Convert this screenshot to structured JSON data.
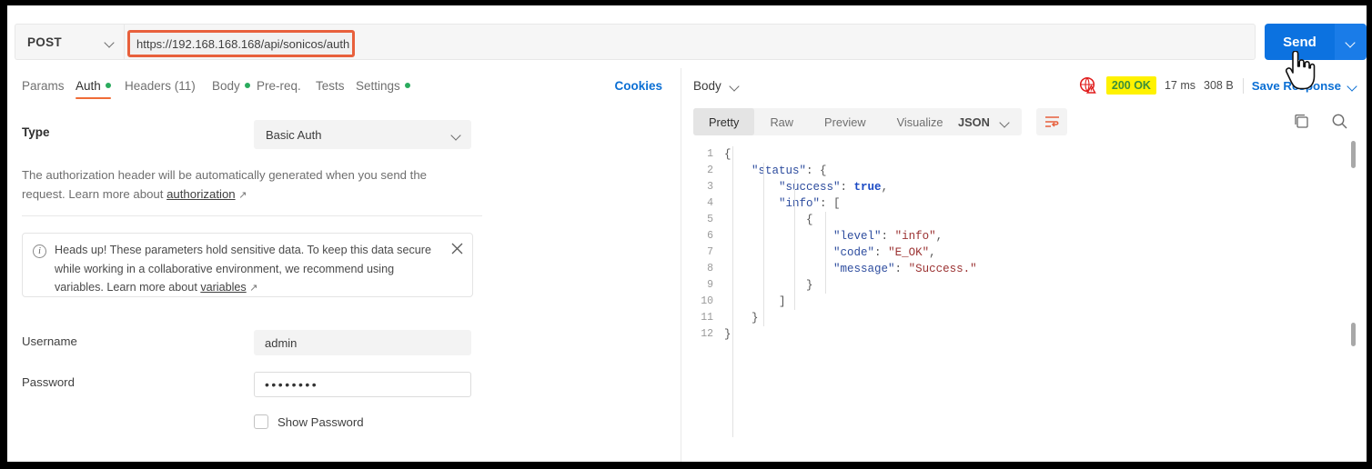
{
  "request": {
    "method": "POST",
    "url": "https://192.168.168.168/api/sonicos/auth",
    "send_label": "Send",
    "tabs": [
      {
        "label": "Params",
        "active": false,
        "dot": false
      },
      {
        "label": "Auth",
        "active": true,
        "dot": true
      },
      {
        "label": "Headers (11)",
        "active": false,
        "dot": false
      },
      {
        "label": "Body",
        "active": false,
        "dot": true
      },
      {
        "label": "Pre-req.",
        "active": false,
        "dot": false
      },
      {
        "label": "Tests",
        "active": false,
        "dot": false
      },
      {
        "label": "Settings",
        "active": false,
        "dot": true
      }
    ],
    "cookies_label": "Cookies"
  },
  "auth": {
    "type_label": "Type",
    "type_value": "Basic Auth",
    "description_part1": "The authorization header will be automatically generated when you send the request. Learn more about ",
    "description_link": "authorization",
    "callout": {
      "text_part1": "Heads up! These parameters hold sensitive data. To keep this data secure while working in a collaborative environment, we recommend using variables. Learn more about ",
      "link": "variables"
    },
    "username_label": "Username",
    "username_value": "admin",
    "password_label": "Password",
    "password_value": "••••••••",
    "show_password_label": "Show Password"
  },
  "response": {
    "body_selector": "Body",
    "status_code": "200 OK",
    "time": "17 ms",
    "size": "308 B",
    "save_response_label": "Save Response",
    "subtabs": [
      {
        "label": "Pretty",
        "active": true
      },
      {
        "label": "Raw",
        "active": false
      },
      {
        "label": "Preview",
        "active": false
      },
      {
        "label": "Visualize",
        "active": false
      }
    ],
    "format": "JSON",
    "code_lines": [
      {
        "n": "1",
        "tokens": [
          {
            "t": "{",
            "c": "br"
          }
        ]
      },
      {
        "n": "2",
        "tokens": [
          {
            "t": "    ",
            "c": "p"
          },
          {
            "t": "\"status\"",
            "c": "k"
          },
          {
            "t": ": {",
            "c": "p"
          }
        ]
      },
      {
        "n": "3",
        "tokens": [
          {
            "t": "        ",
            "c": "p"
          },
          {
            "t": "\"success\"",
            "c": "k"
          },
          {
            "t": ": ",
            "c": "p"
          },
          {
            "t": "true",
            "c": "b"
          },
          {
            "t": ",",
            "c": "p"
          }
        ]
      },
      {
        "n": "4",
        "tokens": [
          {
            "t": "        ",
            "c": "p"
          },
          {
            "t": "\"info\"",
            "c": "k"
          },
          {
            "t": ": [",
            "c": "p"
          }
        ]
      },
      {
        "n": "5",
        "tokens": [
          {
            "t": "            {",
            "c": "p"
          }
        ]
      },
      {
        "n": "6",
        "tokens": [
          {
            "t": "                ",
            "c": "p"
          },
          {
            "t": "\"level\"",
            "c": "k"
          },
          {
            "t": ": ",
            "c": "p"
          },
          {
            "t": "\"info\"",
            "c": "s"
          },
          {
            "t": ",",
            "c": "p"
          }
        ]
      },
      {
        "n": "7",
        "tokens": [
          {
            "t": "                ",
            "c": "p"
          },
          {
            "t": "\"code\"",
            "c": "k"
          },
          {
            "t": ": ",
            "c": "p"
          },
          {
            "t": "\"E_OK\"",
            "c": "s"
          },
          {
            "t": ",",
            "c": "p"
          }
        ]
      },
      {
        "n": "8",
        "tokens": [
          {
            "t": "                ",
            "c": "p"
          },
          {
            "t": "\"message\"",
            "c": "k"
          },
          {
            "t": ": ",
            "c": "p"
          },
          {
            "t": "\"Success.\"",
            "c": "s"
          }
        ]
      },
      {
        "n": "9",
        "tokens": [
          {
            "t": "            }",
            "c": "p"
          }
        ]
      },
      {
        "n": "10",
        "tokens": [
          {
            "t": "        ]",
            "c": "p"
          }
        ]
      },
      {
        "n": "11",
        "tokens": [
          {
            "t": "    }",
            "c": "p"
          }
        ]
      },
      {
        "n": "12",
        "tokens": [
          {
            "t": "}",
            "c": "br"
          }
        ]
      }
    ]
  },
  "colors": {
    "accent_orange": "#f06c37",
    "link_blue": "#0b6fd4",
    "send_blue": "#0c72e0",
    "status_highlight": "#fff200",
    "status_text": "#3b8f3b",
    "green_dot": "#2aab5d"
  }
}
